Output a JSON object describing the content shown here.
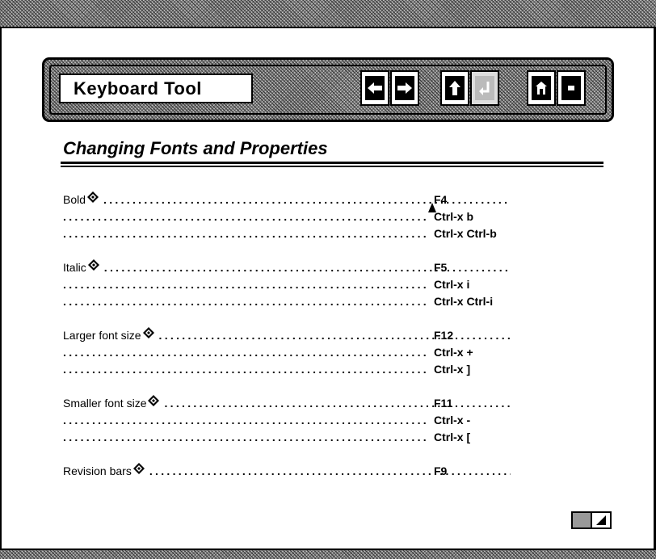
{
  "toolbar": {
    "title": "Keyboard Tool",
    "buttons": [
      {
        "icon": "left-arrow-icon"
      },
      {
        "icon": "right-arrow-icon"
      },
      {
        "icon": "up-arrow-icon"
      },
      {
        "icon": "return-arrow-icon"
      },
      {
        "icon": "home-icon"
      },
      {
        "icon": "stop-icon"
      }
    ]
  },
  "page": {
    "heading": "Changing Fonts and Properties"
  },
  "shortcuts": [
    {
      "label": "Bold",
      "keys": [
        "F4",
        "Ctrl-x b",
        "Ctrl-x Ctrl-b"
      ]
    },
    {
      "label": "Italic",
      "keys": [
        "F5",
        "Ctrl-x i",
        "Ctrl-x Ctrl-i"
      ]
    },
    {
      "label": "Larger font size",
      "keys": [
        "F12",
        "Ctrl-x +",
        "Ctrl-x ]"
      ]
    },
    {
      "label": "Smaller font size",
      "keys": [
        "F11",
        "Ctrl-x -",
        "Ctrl-x ["
      ]
    },
    {
      "label": "Revision bars",
      "keys": [
        "F9"
      ]
    }
  ],
  "dots": "......................................................................................................"
}
